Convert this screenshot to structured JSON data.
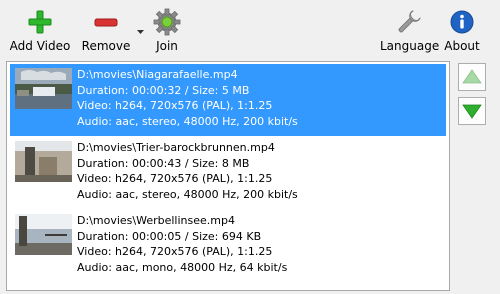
{
  "toolbar": {
    "add_label": "Add Video",
    "remove_label": "Remove",
    "join_label": "Join",
    "language_label": "Language",
    "about_label": "About"
  },
  "videos": [
    {
      "path": "D:\\movies\\Niagarafaelle.mp4",
      "duration_size": "Duration: 00:00:32 / Size: 5 MB",
      "video": "Video: h264, 720x576 (PAL), 1:1.25",
      "audio": "Audio: aac, stereo, 48000 Hz, 200 kbit/s",
      "selected": true
    },
    {
      "path": "D:\\movies\\Trier-barockbrunnen.mp4",
      "duration_size": "Duration: 00:00:43 / Size: 8 MB",
      "video": "Video: h264, 720x576 (PAL), 1:1.25",
      "audio": "Audio: aac, stereo, 48000 Hz, 200 kbit/s",
      "selected": false
    },
    {
      "path": "D:\\movies\\Werbellinsee.mp4",
      "duration_size": "Duration: 00:00:05 / Size: 694 KB",
      "video": "Video: h264, 720x576 (PAL), 1:1.25",
      "audio": "Audio: aac, mono, 48000 Hz, 64 kbit/s",
      "selected": false
    }
  ],
  "icons": {
    "add": "plus-icon",
    "remove": "minus-icon",
    "join": "gear-icon",
    "language": "wrench-icon",
    "about": "info-icon",
    "move_up": "arrow-up-icon",
    "move_down": "arrow-down-icon"
  },
  "colors": {
    "selection": "#3399ff",
    "add_green": "#2db82d",
    "remove_red": "#d83232",
    "about_blue": "#1f63c4"
  }
}
